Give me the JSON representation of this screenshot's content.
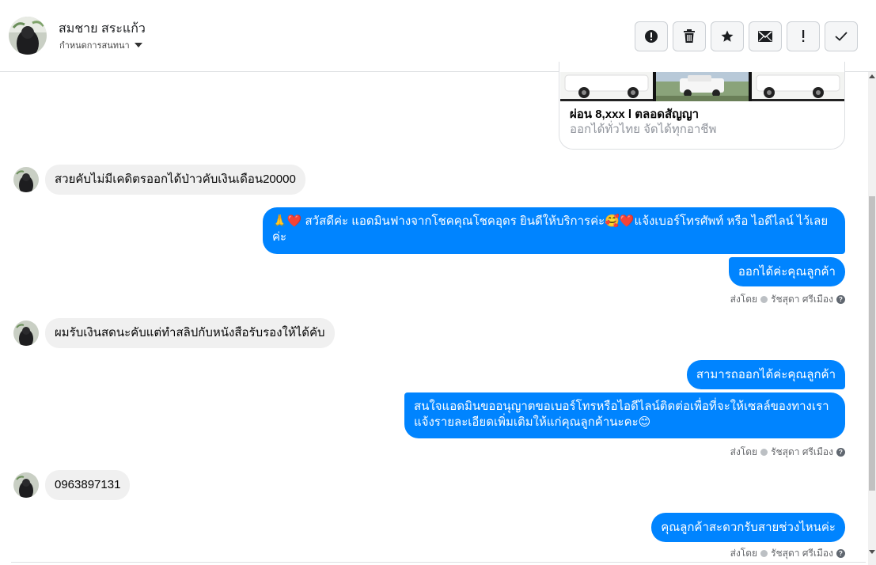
{
  "header": {
    "name": "สมชาย สระแก้ว",
    "sub_label": "กำหนดการสนทนา",
    "actions": [
      {
        "icon": "alert-circle-icon",
        "glyph": "!"
      },
      {
        "icon": "trash-icon",
        "glyph": ""
      },
      {
        "icon": "star-icon",
        "glyph": "★"
      },
      {
        "icon": "envelope-icon",
        "glyph": "✉"
      },
      {
        "icon": "exclamation-icon",
        "glyph": "!"
      },
      {
        "icon": "check-icon",
        "glyph": "✓"
      }
    ]
  },
  "ad_card": {
    "title": "ผ่อน 8,xxx l ตลอดสัญญา",
    "description": "ออกได้ทั่วไทย จัดได้ทุกอาชีพ"
  },
  "messages": [
    {
      "dir": "in",
      "text": "สวยคับไม่มีเคดิตรออกได้ป่าวคับเงินเดือน20000"
    },
    {
      "dir": "out",
      "text": "🙏❤️ สวัสดีค่ะ แอดมินฟางจากโชคคุณโชคอุดร ยินดีให้บริการค่ะ🥰❤️แจ้งเบอร์โทรศัพท์ หรือ ไอดีไลน์  ไว้เลยค่ะ"
    },
    {
      "dir": "out",
      "text": "ออกได้ค่ะคุณลูกค้า"
    },
    {
      "dir": "sentby",
      "prefix": "ส่งโดย",
      "agent": "รัชสุดา ศรีเมือง"
    },
    {
      "dir": "in",
      "text": "ผมรับเงินสดนะคับแต่ทำสลิปกับหนังสือรับรองให้ได้คับ"
    },
    {
      "dir": "out",
      "text": "สามารถออกได้ค่ะคุณลูกค้า"
    },
    {
      "dir": "out",
      "text": "สนใจแอดมินขออนุญาตขอเบอร์โทรหรือไอดีไลน์ติดต่อเพื่อที่จะให้เซลล์ของทางเราแจ้งรายละเอียดเพิ่มเติมให้แก่คุณลูกค้านะคะ😊"
    },
    {
      "dir": "sentby",
      "prefix": "ส่งโดย",
      "agent": "รัชสุดา ศรีเมือง"
    },
    {
      "dir": "in",
      "text": "0963897131"
    },
    {
      "dir": "out",
      "text": "คุณลูกค้าสะดวกรับสายช่วงไหนค่ะ"
    },
    {
      "dir": "sentby",
      "prefix": "ส่งโดย",
      "agent": "รัชสุดา ศรีเมือง"
    }
  ],
  "colors": {
    "outgoing_bubble": "#0084ff",
    "incoming_bubble": "#f0f0f0"
  }
}
